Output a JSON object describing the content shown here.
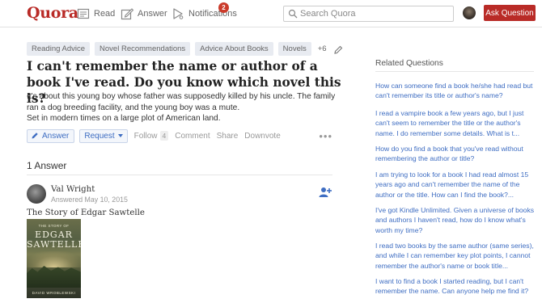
{
  "header": {
    "logo": "Quora",
    "nav": {
      "read": "Read",
      "answer": "Answer",
      "notifications": "Notifications",
      "notifications_count": "2"
    },
    "search_placeholder": "Search Quora",
    "ask_button": "Ask Question",
    "accent_color": "#b92b27"
  },
  "question": {
    "topics": [
      "Reading Advice",
      "Novel Recommendations",
      "Advice About Books",
      "Novels"
    ],
    "more_topics": "+6",
    "title": "I can't remember the name or author of a book I've read. Do you know which novel this is?",
    "detail_line1": "It's about this young boy whose father was supposedly killed by his uncle.  The family ran a dog breeding facility, and the young boy was a mute.",
    "detail_line2": "Set in modern times on a large plot of American land.",
    "actions": {
      "answer": "Answer",
      "request": "Request",
      "follow": "Follow",
      "follow_count": "4",
      "comment": "Comment",
      "share": "Share",
      "downvote": "Downvote",
      "more": "•••"
    }
  },
  "answers": {
    "count_label": "1 Answer",
    "items": [
      {
        "author": "Val Wright",
        "answered": "Answered May 10, 2015",
        "text": "The Story of Edgar Sawtelle",
        "book_cover": {
          "line1": "THE STORY OF",
          "line2": "EDGAR",
          "line3": "SAWTELLE",
          "author": "DAVID WROBLEWSKI"
        }
      }
    ]
  },
  "sidebar": {
    "heading": "Related Questions",
    "questions": [
      "How can someone find a book he/she had read but can't remember its title or author's name?",
      "I read a vampire book a few years ago, but I just can't seem to remember the title or the author's name. I do remember some details. What is t...",
      "How do you find a book that you've read without remembering the author or title?",
      "I am trying to look for a book I had read almost 15 years ago and can't remember the name of the author or the title. How can I find the book?...",
      "I've got Kindle Unlimited. Given a universe of books and authors I haven't read, how do I know what's worth my time?",
      "I read two books by the same author (same series), and while I can remember key plot points, I cannot remember the author's name or book title...",
      "I want to find a book I started reading, but I can't remember the name. Can anyone help me find it?"
    ]
  }
}
